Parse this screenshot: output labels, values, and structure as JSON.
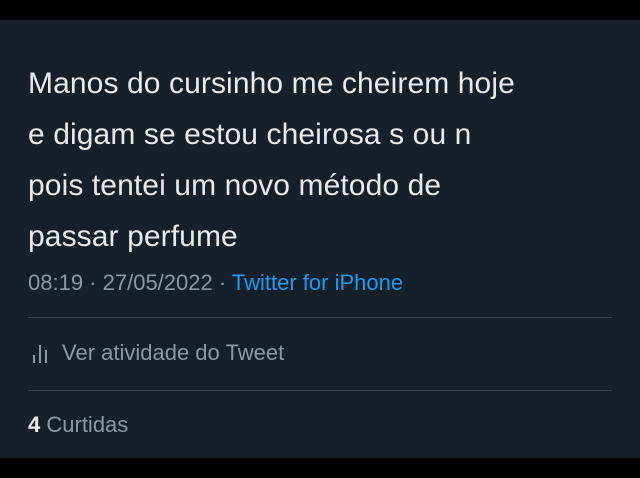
{
  "tweet": {
    "text": "Manos do cursinho me cheirem hoje\ne digam se estou cheirosa s ou n\npois tentei um novo método de\npassar perfume",
    "time": "08:19",
    "separator": " · ",
    "date": "27/05/2022",
    "source": "Twitter for iPhone"
  },
  "activity": {
    "icon": "analytics-bars-icon",
    "label": "Ver atividade do Tweet"
  },
  "stats": {
    "likes_count": "4",
    "likes_label": "Curtidas"
  },
  "colors": {
    "background": "#15202b",
    "text": "#e7e9ea",
    "secondary": "#8b98a5",
    "link": "#1d9bf0",
    "divider": "#38444d"
  }
}
